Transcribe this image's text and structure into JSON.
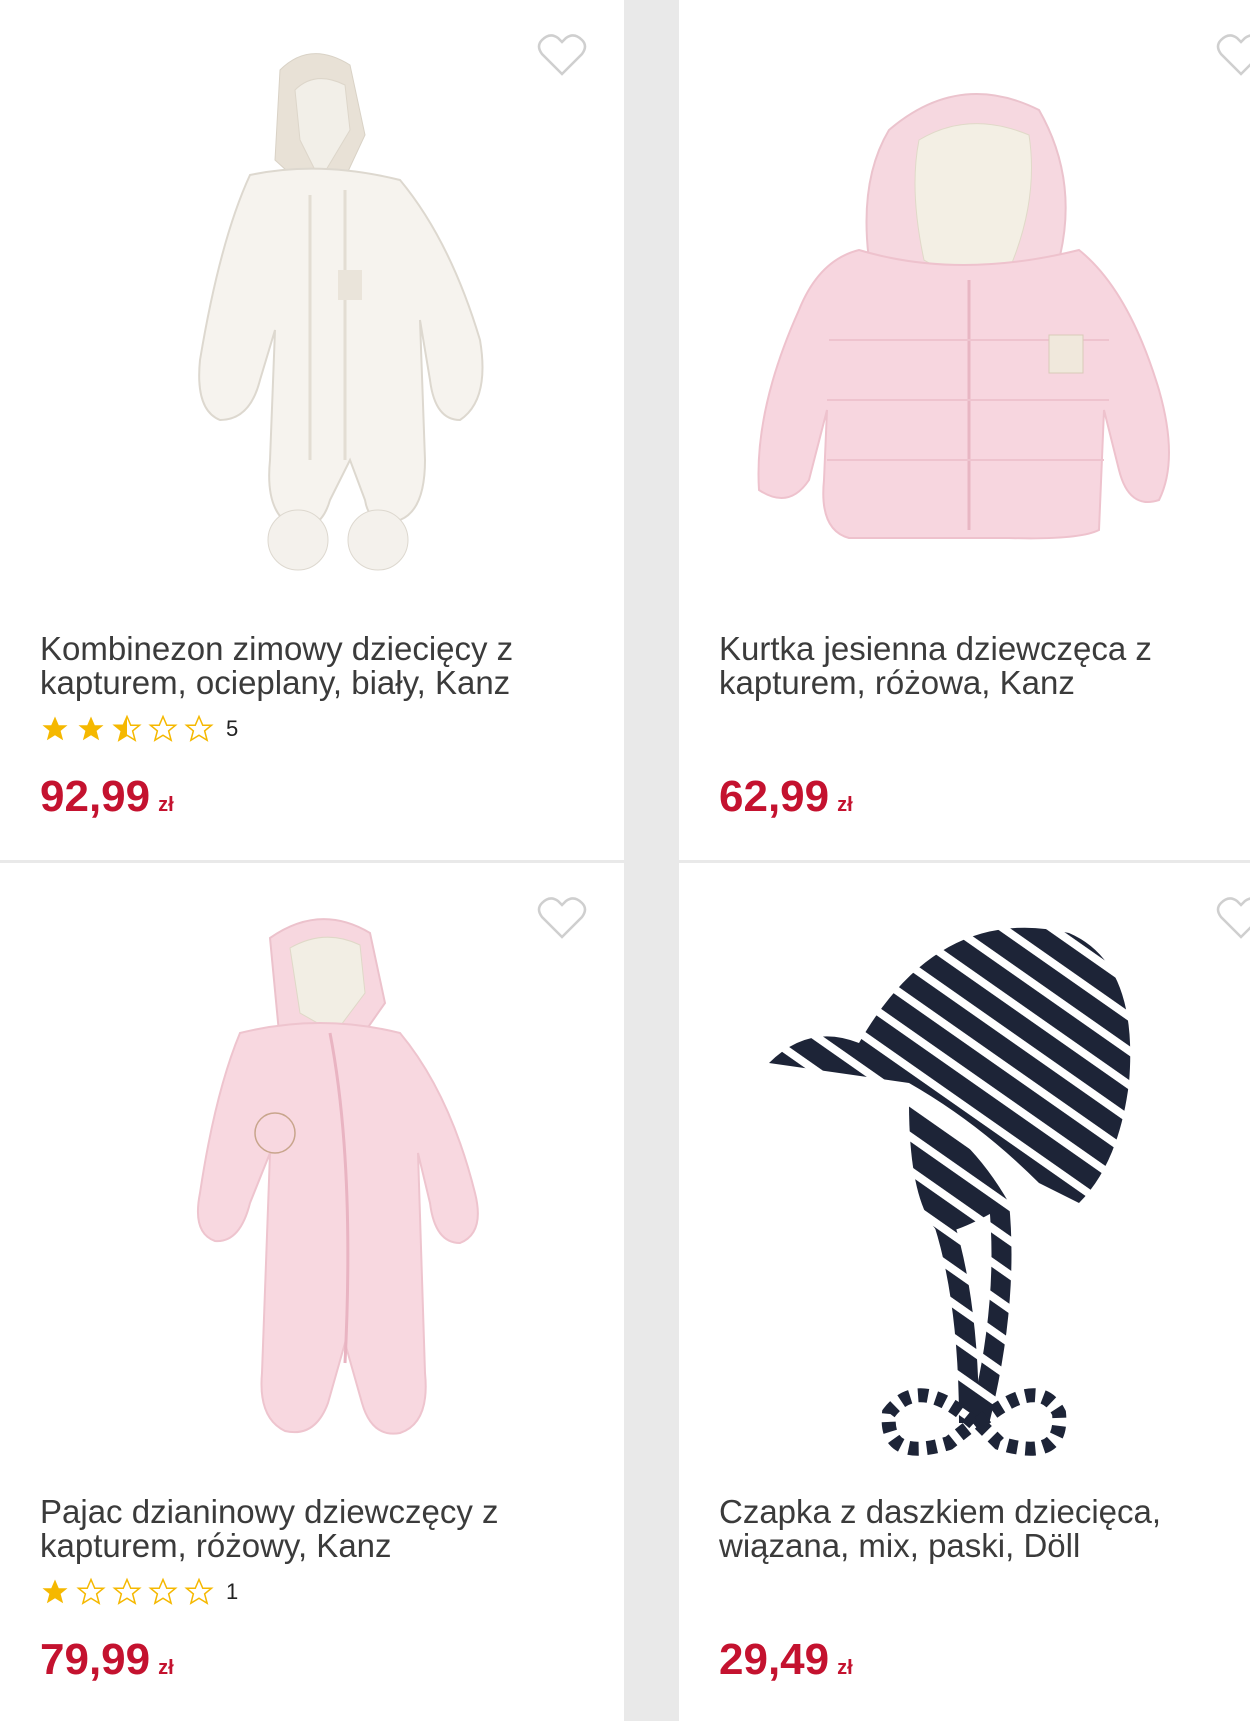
{
  "products": [
    {
      "title": "Kombinezon zimowy dziecięcy z kapturem, ocieplany, biały, Kanz",
      "rating_count": "5",
      "rating": 2.5,
      "price": "92,99",
      "currency": "zł",
      "image_icon": "white-snowsuit-image"
    },
    {
      "title": "Kurtka jesienna dziewczęca z kapturem, różowa, Kanz",
      "rating_count": "",
      "rating": 0,
      "price": "62,99",
      "currency": "zł",
      "image_icon": "pink-jacket-image"
    },
    {
      "title": "Pajac dzianinowy dziewczęcy z kapturem, różowy, Kanz",
      "rating_count": "1",
      "rating": 1,
      "price": "79,99",
      "currency": "zł",
      "image_icon": "pink-romper-image"
    },
    {
      "title": "Czapka z daszkiem dziecięca, wiązana, mix, paski, Döll",
      "rating_count": "",
      "rating": 0,
      "price": "29,49",
      "currency": "zł",
      "image_icon": "striped-cap-image"
    }
  ],
  "colors": {
    "price": "#c4122f",
    "star": "#f5b800",
    "background": "#e9e9e9"
  }
}
